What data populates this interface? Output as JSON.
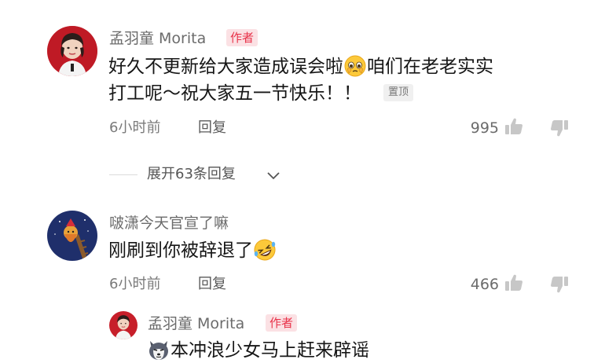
{
  "comments": [
    {
      "username": "孟羽童 Morita",
      "badge": "作者",
      "text_line1_part1": "好久不更新给大家造成误会啦",
      "text_line1_emoji": "pleading-face-emoji",
      "text_line1_part2": "咱们在老老实实",
      "text_line2": "打工呢～祝大家五一节快乐！！",
      "pinned_label": "置顶",
      "time": "6小时前",
      "reply_label": "回复",
      "likes": "995",
      "like_icon": "thumbs-up-icon",
      "dislike_icon": "thumbs-down-icon"
    },
    {
      "username": "啵潇今天官宣了嘛",
      "text": "刚刷到你被辞退了",
      "text_emoji": "rolling-laughing-emoji",
      "time": "6小时前",
      "reply_label": "回复",
      "likes": "466",
      "like_icon": "thumbs-up-icon",
      "dislike_icon": "thumbs-down-icon"
    }
  ],
  "expand_replies": {
    "label": "展开63条回复",
    "icon": "chevron-down-icon"
  },
  "reply": {
    "username": "孟羽童 Morita",
    "badge": "作者",
    "text_emoji": "husky-dog-emoji",
    "text": "本冲浪少女马上赶来辟谣"
  },
  "colors": {
    "badge_text": "#e8334a",
    "badge_bg": "#fbe1e4",
    "primary_text": "#161616",
    "secondary_text": "#6b6b6b"
  }
}
